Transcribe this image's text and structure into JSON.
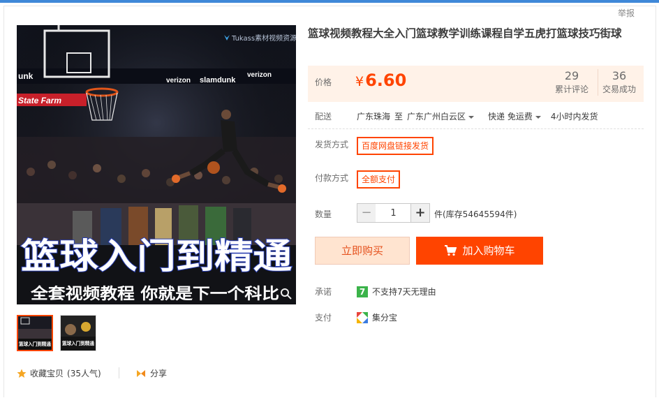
{
  "header": {
    "report_label": "举报"
  },
  "gallery": {
    "watermark": "Tukass素材视频资源",
    "overlay_big": "篮球入门到精通",
    "overlay_small": "全套视频教程 你就是下一个科比",
    "banner_text_1": "unk",
    "banner_text_2": "verizon",
    "banner_text_3": "slamdunk",
    "banner_text_4": "verizon",
    "statefarm": "State Farm",
    "thumb1_caption": "篮球入门到精通",
    "thumb2_caption": "篮球入门到精通"
  },
  "actions_bottom": {
    "favorite_label": "收藏宝贝",
    "favorite_count": "(35人气)",
    "share_label": "分享"
  },
  "product": {
    "title": "篮球视频教程大全入门篮球教学训练课程自学五虎打篮球技巧街球",
    "price_label": "价格",
    "currency": "¥",
    "price": "6.60",
    "reviews_count": "29",
    "reviews_label": "累计评论",
    "sales_count": "36",
    "sales_label": "交易成功"
  },
  "delivery": {
    "label": "配送",
    "from": "广东珠海",
    "to_word": "至",
    "to": "广东广州白云区",
    "method": "快递 免运费",
    "time": "4小时内发货"
  },
  "options": {
    "shipping_label": "发货方式",
    "shipping_value": "百度网盘链接发货",
    "payment_label": "付款方式",
    "payment_value": "全额支付"
  },
  "quantity": {
    "label": "数量",
    "value": "1",
    "minus": "−",
    "plus": "+",
    "stock_text": "件(库存54645594件)"
  },
  "buttons": {
    "buy_now": "立即购买",
    "add_to_cart": "加入购物车"
  },
  "service": {
    "promise_label": "承诺",
    "promise_text": "不支持7天无理由",
    "promise_icon_text": "7",
    "pay_label": "支付",
    "pay_text": "集分宝"
  },
  "colors": {
    "accent": "#ff4400",
    "price": "#ff4400",
    "topbar": "#3f88d8"
  }
}
